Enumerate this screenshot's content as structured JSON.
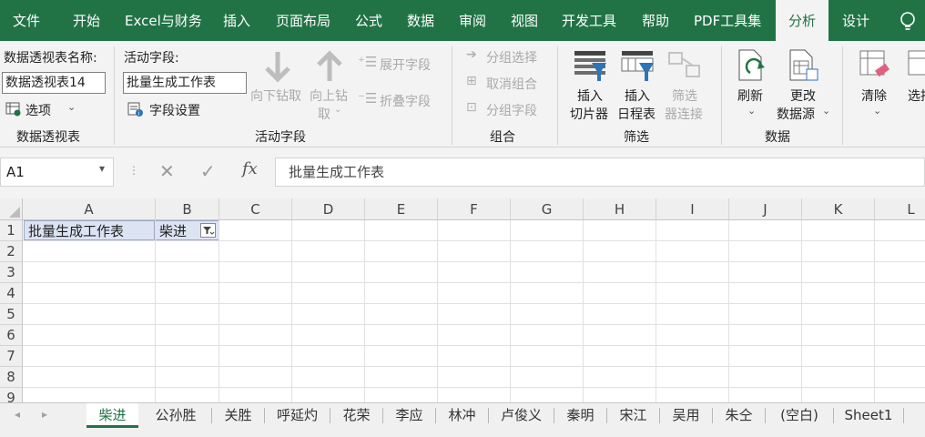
{
  "ribbon_tabs": [
    "文件",
    "开始",
    "Excel与财务",
    "插入",
    "页面布局",
    "公式",
    "数据",
    "审阅",
    "视图",
    "开发工具",
    "帮助",
    "PDF工具集",
    "分析",
    "设计"
  ],
  "active_ribbon_tab": "分析",
  "pivot_group": {
    "name_label": "数据透视表名称:",
    "name_value": "数据透视表14",
    "options_label": "选项",
    "group_label": "数据透视表"
  },
  "active_field_group": {
    "field_label": "活动字段:",
    "field_value": "批量生成工作表",
    "field_settings_label": "字段设置",
    "drill_down_label": "向下钻取",
    "drill_up_label_1": "向上钻",
    "drill_up_label_2": "取",
    "expand_label": "展开字段",
    "collapse_label": "折叠字段",
    "group_label": "活动字段"
  },
  "grouping_group": {
    "group_selection_label": "分组选择",
    "ungroup_label": "取消组合",
    "group_field_label": "分组字段",
    "group_label": "组合"
  },
  "filter_group": {
    "slicer_label_1": "插入",
    "slicer_label_2": "切片器",
    "timeline_label_1": "插入",
    "timeline_label_2": "日程表",
    "filter_conn_label_1": "筛选",
    "filter_conn_label_2": "器连接",
    "group_label": "筛选"
  },
  "data_group": {
    "refresh_label": "刷新",
    "change_source_label_1": "更改",
    "change_source_label_2": "数据源",
    "group_label": "数据"
  },
  "actions_group": {
    "clear_label": "清除",
    "select_label": "选择"
  },
  "formula_bar": {
    "cell_ref": "A1",
    "fx_label": "fx",
    "content": "批量生成工作表"
  },
  "grid": {
    "columns": [
      "A",
      "B",
      "C",
      "D",
      "E",
      "F",
      "G",
      "H",
      "I",
      "J",
      "K",
      "L"
    ],
    "rows": [
      "1",
      "2",
      "3",
      "4",
      "5",
      "6",
      "7",
      "8",
      "9"
    ],
    "a1": "批量生成工作表",
    "b1": "柴进"
  },
  "sheet_tabs": [
    "柴进",
    "公孙胜",
    "关胜",
    "呼延灼",
    "花荣",
    "李应",
    "林冲",
    "卢俊义",
    "秦明",
    "宋江",
    "吴用",
    "朱仝",
    "(空白)",
    "Sheet1"
  ],
  "active_sheet": "柴进",
  "colors": {
    "excel_green": "#217346",
    "pivot_header_bg": "#dce4f4"
  }
}
